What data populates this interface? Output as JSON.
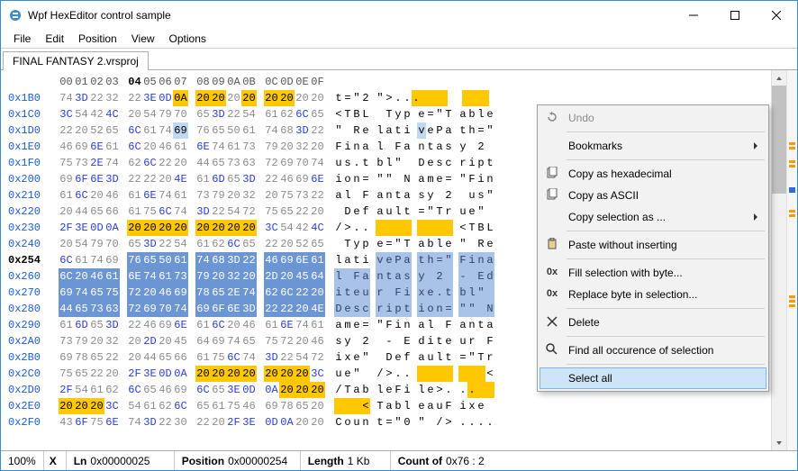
{
  "window": {
    "title": "Wpf HexEditor control sample"
  },
  "menubar": [
    "File",
    "Edit",
    "Position",
    "View",
    "Options"
  ],
  "tab": "FINAL FANTASY 2.vrsproj",
  "header_cols": [
    "00",
    "01",
    "02",
    "03",
    "",
    "04",
    "05",
    "06",
    "07",
    "",
    "08",
    "09",
    "0A",
    "0B",
    "",
    "0C",
    "0D",
    "0E",
    "0F"
  ],
  "rows": [
    {
      "off": "0x1B0",
      "b": false,
      "hex": [
        "74",
        "3D",
        "22",
        "32",
        "",
        "22",
        "3E",
        "0D",
        "0A",
        "",
        "20",
        "20",
        "20",
        "20",
        "",
        "20",
        "20",
        "20",
        "20"
      ],
      "asc": [
        "t",
        "=",
        "\"",
        "2",
        "",
        "\"",
        ">",
        ".",
        ".",
        ".",
        " ",
        " ",
        " ",
        " ",
        "",
        " ",
        " ",
        " ",
        " "
      ],
      "hhl": {
        "8": "g",
        "9": "g",
        "10": "g",
        "11": "g",
        "13": "g",
        "14": "g",
        "15": "g",
        "16": "g"
      },
      "ahl": {
        "9": "g",
        "10": "g",
        "11": "g",
        "12": "g",
        "14": "g",
        "15": "g",
        "16": "g",
        "17": "g"
      }
    },
    {
      "off": "0x1C0",
      "b": false,
      "hex": [
        "3C",
        "54",
        "42",
        "4C",
        "",
        "20",
        "54",
        "79",
        "70",
        "",
        "65",
        "3D",
        "22",
        "54",
        "",
        "61",
        "62",
        "6C",
        "65"
      ],
      "asc": [
        "<",
        "T",
        "B",
        "L",
        "",
        " ",
        "T",
        "y",
        "p",
        "",
        "e",
        "=",
        "\"",
        "T",
        "",
        "a",
        "b",
        "l",
        "e"
      ],
      "hhl": {},
      "ahl": {}
    },
    {
      "off": "0x1D0",
      "b": false,
      "hex": [
        "22",
        "20",
        "52",
        "65",
        "",
        "6C",
        "61",
        "74",
        "69",
        "",
        "76",
        "65",
        "50",
        "61",
        "",
        "74",
        "68",
        "3D",
        "22"
      ],
      "asc": [
        "\"",
        " ",
        "R",
        "e",
        "",
        "l",
        "a",
        "t",
        "i",
        "",
        "v",
        "e",
        "P",
        "a",
        "",
        "t",
        "h",
        "=",
        "\""
      ],
      "hhl": {
        "8": "c"
      },
      "ahl": {
        "10": "c"
      }
    },
    {
      "off": "0x1E0",
      "b": false,
      "hex": [
        "46",
        "69",
        "6E",
        "61",
        "",
        "6C",
        "20",
        "46",
        "61",
        "",
        "6E",
        "74",
        "61",
        "73",
        "",
        "79",
        "20",
        "32",
        "20"
      ],
      "asc": [
        "F",
        "i",
        "n",
        "a",
        "",
        "l",
        " ",
        "F",
        "a",
        "",
        "n",
        "t",
        "a",
        "s",
        "",
        "y",
        " ",
        "2",
        " "
      ],
      "hhl": {},
      "ahl": {}
    },
    {
      "off": "0x1F0",
      "b": false,
      "hex": [
        "75",
        "73",
        "2E",
        "74",
        "",
        "62",
        "6C",
        "22",
        "20",
        "",
        "44",
        "65",
        "73",
        "63",
        "",
        "72",
        "69",
        "70",
        "74"
      ],
      "asc": [
        "u",
        "s",
        ".",
        "t",
        "",
        "b",
        "l",
        "\"",
        " ",
        "",
        "D",
        "e",
        "s",
        "c",
        "",
        "r",
        "i",
        "p",
        "t"
      ],
      "hhl": {},
      "ahl": {}
    },
    {
      "off": "0x200",
      "b": false,
      "hex": [
        "69",
        "6F",
        "6E",
        "3D",
        "",
        "22",
        "22",
        "20",
        "4E",
        "",
        "61",
        "6D",
        "65",
        "3D",
        "",
        "22",
        "46",
        "69",
        "6E"
      ],
      "asc": [
        "i",
        "o",
        "n",
        "=",
        "",
        "\"",
        "\"",
        " ",
        "N",
        "",
        "a",
        "m",
        "e",
        "=",
        "",
        "\"",
        "F",
        "i",
        "n"
      ],
      "hhl": {},
      "ahl": {}
    },
    {
      "off": "0x210",
      "b": false,
      "hex": [
        "61",
        "6C",
        "20",
        "46",
        "",
        "61",
        "6E",
        "74",
        "61",
        "",
        "73",
        "79",
        "20",
        "32",
        "",
        "20",
        "75",
        "73",
        "22"
      ],
      "asc": [
        "a",
        "l",
        " ",
        "F",
        "",
        "a",
        "n",
        "t",
        "a",
        "",
        "s",
        "y",
        " ",
        "2",
        "",
        " ",
        "u",
        "s",
        "\""
      ],
      "hhl": {},
      "ahl": {}
    },
    {
      "off": "0x220",
      "b": false,
      "hex": [
        "20",
        "44",
        "65",
        "66",
        "",
        "61",
        "75",
        "6C",
        "74",
        "",
        "3D",
        "22",
        "54",
        "72",
        "",
        "75",
        "65",
        "22",
        "20"
      ],
      "asc": [
        " ",
        "D",
        "e",
        "f",
        "",
        "a",
        "u",
        "l",
        "t",
        "",
        "=",
        "\"",
        "T",
        "r",
        "",
        "u",
        "e",
        "\"",
        " "
      ],
      "hhl": {},
      "ahl": {}
    },
    {
      "off": "0x230",
      "b": false,
      "hex": [
        "2F",
        "3E",
        "0D",
        "0A",
        "",
        "20",
        "20",
        "20",
        "20",
        "",
        "20",
        "20",
        "20",
        "20",
        "",
        "3C",
        "54",
        "42",
        "4C"
      ],
      "asc": [
        "/",
        ">",
        ".",
        ".",
        "",
        " ",
        " ",
        " ",
        " ",
        "",
        " ",
        " ",
        " ",
        " ",
        "",
        "<",
        "T",
        "B",
        "L"
      ],
      "hhl": {
        "5": "g",
        "6": "g",
        "7": "g",
        "8": "g",
        "10": "g",
        "11": "g",
        "12": "g",
        "13": "g"
      },
      "ahl": {
        "5": "g",
        "6": "g",
        "7": "g",
        "8": "g",
        "10": "g",
        "11": "g",
        "12": "g",
        "13": "g"
      }
    },
    {
      "off": "0x240",
      "b": false,
      "hex": [
        "20",
        "54",
        "79",
        "70",
        "",
        "65",
        "3D",
        "22",
        "54",
        "",
        "61",
        "62",
        "6C",
        "65",
        "",
        "22",
        "20",
        "52",
        "65"
      ],
      "asc": [
        " ",
        "T",
        "y",
        "p",
        "",
        "e",
        "=",
        "\"",
        "T",
        "",
        "a",
        "b",
        "l",
        "e",
        "",
        "\"",
        " ",
        "R",
        "e"
      ],
      "hhl": {},
      "ahl": {}
    },
    {
      "off": "0x254",
      "b": true,
      "hex": [
        "6C",
        "61",
        "74",
        "69",
        "",
        "76",
        "65",
        "50",
        "61",
        "",
        "74",
        "68",
        "3D",
        "22",
        "",
        "46",
        "69",
        "6E",
        "61"
      ],
      "asc": [
        "l",
        "a",
        "t",
        "i",
        "",
        "v",
        "e",
        "P",
        "a",
        "",
        "t",
        "h",
        "=",
        "\"",
        "",
        "F",
        "i",
        "n",
        "a"
      ],
      "hhl": {
        "5": "s",
        "6": "s",
        "7": "s",
        "8": "s",
        "10": "s",
        "11": "s",
        "12": "s",
        "13": "s",
        "15": "s",
        "16": "s",
        "17": "s",
        "18": "s"
      },
      "ahl": {
        "5": "a",
        "6": "a",
        "7": "a",
        "8": "a",
        "10": "a",
        "11": "a",
        "12": "a",
        "13": "a",
        "15": "a",
        "16": "a",
        "17": "a",
        "18": "a"
      }
    },
    {
      "off": "0x260",
      "b": false,
      "hex": [
        "6C",
        "20",
        "46",
        "61",
        "",
        "6E",
        "74",
        "61",
        "73",
        "",
        "79",
        "20",
        "32",
        "20",
        "",
        "2D",
        "20",
        "45",
        "64"
      ],
      "asc": [
        "l",
        " ",
        "F",
        "a",
        "",
        "n",
        "t",
        "a",
        "s",
        "",
        "y",
        " ",
        "2",
        " ",
        "",
        "-",
        " ",
        "E",
        "d"
      ],
      "hhl": {
        "0": "s",
        "1": "s",
        "2": "s",
        "3": "s",
        "5": "s",
        "6": "s",
        "7": "s",
        "8": "s",
        "10": "s",
        "11": "s",
        "12": "s",
        "13": "s",
        "15": "s",
        "16": "s",
        "17": "s",
        "18": "s"
      },
      "ahl": {
        "0": "a",
        "1": "a",
        "2": "a",
        "3": "a",
        "5": "a",
        "6": "a",
        "7": "a",
        "8": "a",
        "10": "a",
        "11": "a",
        "12": "a",
        "13": "a",
        "15": "a",
        "16": "a",
        "17": "a",
        "18": "a"
      }
    },
    {
      "off": "0x270",
      "b": false,
      "hex": [
        "69",
        "74",
        "65",
        "75",
        "",
        "72",
        "20",
        "46",
        "69",
        "",
        "78",
        "65",
        "2E",
        "74",
        "",
        "62",
        "6C",
        "22",
        "20"
      ],
      "asc": [
        "i",
        "t",
        "e",
        "u",
        "",
        "r",
        " ",
        "F",
        "i",
        "",
        "x",
        "e",
        ".",
        "t",
        "",
        "b",
        "l",
        "\"",
        " "
      ],
      "hhl": {
        "0": "s",
        "1": "s",
        "2": "s",
        "3": "s",
        "5": "s",
        "6": "s",
        "7": "s",
        "8": "s",
        "10": "s",
        "11": "s",
        "12": "s",
        "13": "s",
        "15": "s",
        "16": "s",
        "17": "s",
        "18": "s"
      },
      "ahl": {
        "0": "a",
        "1": "a",
        "2": "a",
        "3": "a",
        "5": "a",
        "6": "a",
        "7": "a",
        "8": "a",
        "10": "a",
        "11": "a",
        "12": "a",
        "13": "a",
        "15": "a",
        "16": "a",
        "17": "a",
        "18": "a"
      }
    },
    {
      "off": "0x280",
      "b": false,
      "hex": [
        "44",
        "65",
        "73",
        "63",
        "",
        "72",
        "69",
        "70",
        "74",
        "",
        "69",
        "6F",
        "6E",
        "3D",
        "",
        "22",
        "22",
        "20",
        "4E"
      ],
      "asc": [
        "D",
        "e",
        "s",
        "c",
        "",
        "r",
        "i",
        "p",
        "t",
        "",
        "i",
        "o",
        "n",
        "=",
        "",
        "\"",
        "\"",
        " ",
        "N"
      ],
      "hhl": {
        "0": "s",
        "1": "s",
        "2": "s",
        "3": "s",
        "5": "s",
        "6": "s",
        "7": "s",
        "8": "s",
        "10": "s",
        "11": "s",
        "12": "s",
        "13": "s",
        "15": "s",
        "16": "s",
        "17": "s",
        "18": "s"
      },
      "ahl": {
        "0": "a",
        "1": "a",
        "2": "a",
        "3": "a",
        "5": "a",
        "6": "a",
        "7": "a",
        "8": "a",
        "10": "a",
        "11": "a",
        "12": "a",
        "13": "a",
        "15": "a",
        "16": "a",
        "17": "a",
        "18": "a"
      }
    },
    {
      "off": "0x290",
      "b": false,
      "hex": [
        "61",
        "6D",
        "65",
        "3D",
        "",
        "22",
        "46",
        "69",
        "6E",
        "",
        "61",
        "6C",
        "20",
        "46",
        "",
        "61",
        "6E",
        "74",
        "61"
      ],
      "asc": [
        "a",
        "m",
        "e",
        "=",
        "",
        "\"",
        "F",
        "i",
        "n",
        "",
        "a",
        "l",
        " ",
        "F",
        "",
        "a",
        "n",
        "t",
        "a"
      ],
      "hhl": {},
      "ahl": {}
    },
    {
      "off": "0x2A0",
      "b": false,
      "hex": [
        "73",
        "79",
        "20",
        "32",
        "",
        "20",
        "2D",
        "20",
        "45",
        "",
        "64",
        "69",
        "74",
        "65",
        "",
        "75",
        "72",
        "20",
        "46"
      ],
      "asc": [
        "s",
        "y",
        " ",
        "2",
        "",
        " ",
        "-",
        " ",
        "E",
        "",
        "d",
        "i",
        "t",
        "e",
        "",
        "u",
        "r",
        " ",
        "F"
      ],
      "hhl": {},
      "ahl": {}
    },
    {
      "off": "0x2B0",
      "b": false,
      "hex": [
        "69",
        "78",
        "65",
        "22",
        "",
        "20",
        "44",
        "65",
        "66",
        "",
        "61",
        "75",
        "6C",
        "74",
        "",
        "3D",
        "22",
        "54",
        "72"
      ],
      "asc": [
        "i",
        "x",
        "e",
        "\"",
        "",
        " ",
        "D",
        "e",
        "f",
        "",
        "a",
        "u",
        "l",
        "t",
        "",
        "=",
        "\"",
        "T",
        "r"
      ],
      "hhl": {},
      "ahl": {}
    },
    {
      "off": "0x2C0",
      "b": false,
      "hex": [
        "75",
        "65",
        "22",
        "20",
        "",
        "2F",
        "3E",
        "0D",
        "0A",
        "",
        "20",
        "20",
        "20",
        "20",
        "",
        "20",
        "20",
        "20",
        "3C"
      ],
      "asc": [
        "u",
        "e",
        "\"",
        " ",
        "",
        "/",
        ">",
        ".",
        ".",
        "",
        " ",
        " ",
        " ",
        " ",
        "",
        " ",
        " ",
        " ",
        "<"
      ],
      "hhl": {
        "10": "g",
        "11": "g",
        "12": "g",
        "13": "g",
        "15": "g",
        "16": "g",
        "17": "g"
      },
      "ahl": {
        "10": "g",
        "11": "g",
        "12": "g",
        "13": "g",
        "15": "g",
        "16": "g",
        "17": "g"
      }
    },
    {
      "off": "0x2D0",
      "b": false,
      "hex": [
        "2F",
        "54",
        "61",
        "62",
        "",
        "6C",
        "65",
        "46",
        "69",
        "",
        "6C",
        "65",
        "3E",
        "0D",
        "",
        "0A",
        "20",
        "20",
        "20"
      ],
      "asc": [
        "/",
        "T",
        "a",
        "b",
        "",
        "l",
        "e",
        "F",
        "i",
        "",
        "l",
        "e",
        ">",
        ".",
        "",
        ".",
        ".",
        " ",
        " "
      ],
      "hhl": {
        "16": "g",
        "17": "g",
        "18": "g"
      },
      "ahl": {
        "16": "g",
        "17": "g",
        "18": "g"
      }
    },
    {
      "off": "0x2E0",
      "b": false,
      "hex": [
        "20",
        "20",
        "20",
        "3C",
        "",
        "54",
        "61",
        "62",
        "6C",
        "",
        "65",
        "61",
        "75",
        "46",
        "",
        "69",
        "78",
        "65",
        "20"
      ],
      "asc": [
        " ",
        " ",
        " ",
        "<",
        "",
        "T",
        "a",
        "b",
        "l",
        "",
        "e",
        "a",
        "u",
        "F",
        "",
        "i",
        "x",
        "e",
        " "
      ],
      "hhl": {
        "0": "g",
        "1": "g",
        "2": "g"
      },
      "ahl": {
        "0": "g",
        "1": "g",
        "2": "g",
        "3": "g"
      }
    },
    {
      "off": "0x2F0",
      "b": false,
      "hex": [
        "43",
        "6F",
        "75",
        "6E",
        "",
        "74",
        "3D",
        "22",
        "30",
        "",
        "22",
        "20",
        "2F",
        "3E",
        "",
        "0D",
        "0A",
        "20",
        "20"
      ],
      "asc": [
        "C",
        "o",
        "u",
        "n",
        "",
        "t",
        "=",
        "\"",
        "0",
        "",
        "\"",
        " ",
        "/",
        ">",
        "",
        ".",
        ".",
        ".",
        "."
      ],
      "hhl": {},
      "ahl": {}
    }
  ],
  "context_menu": {
    "undo": "Undo",
    "bookmarks": "Bookmarks",
    "copy_hex": "Copy as hexadecimal",
    "copy_ascii": "Copy as ASCII",
    "copy_sel_as": "Copy selection as ...",
    "paste_no_insert": "Paste without inserting",
    "fill_byte": "Fill selection with byte...",
    "replace_byte": "Replace byte in selection...",
    "delete": "Delete",
    "find_all": "Find all occurence of selection",
    "select_all": "Select all"
  },
  "statusbar": {
    "zoom": "100%",
    "x_label": "X",
    "ln_label": "Ln",
    "ln_value": "0x00000025",
    "pos_label": "Position",
    "pos_value": "0x00000254",
    "len_label": "Length",
    "len_value": "1 Kb",
    "count_label": "Count of",
    "count_value": "0x76 : 2"
  }
}
